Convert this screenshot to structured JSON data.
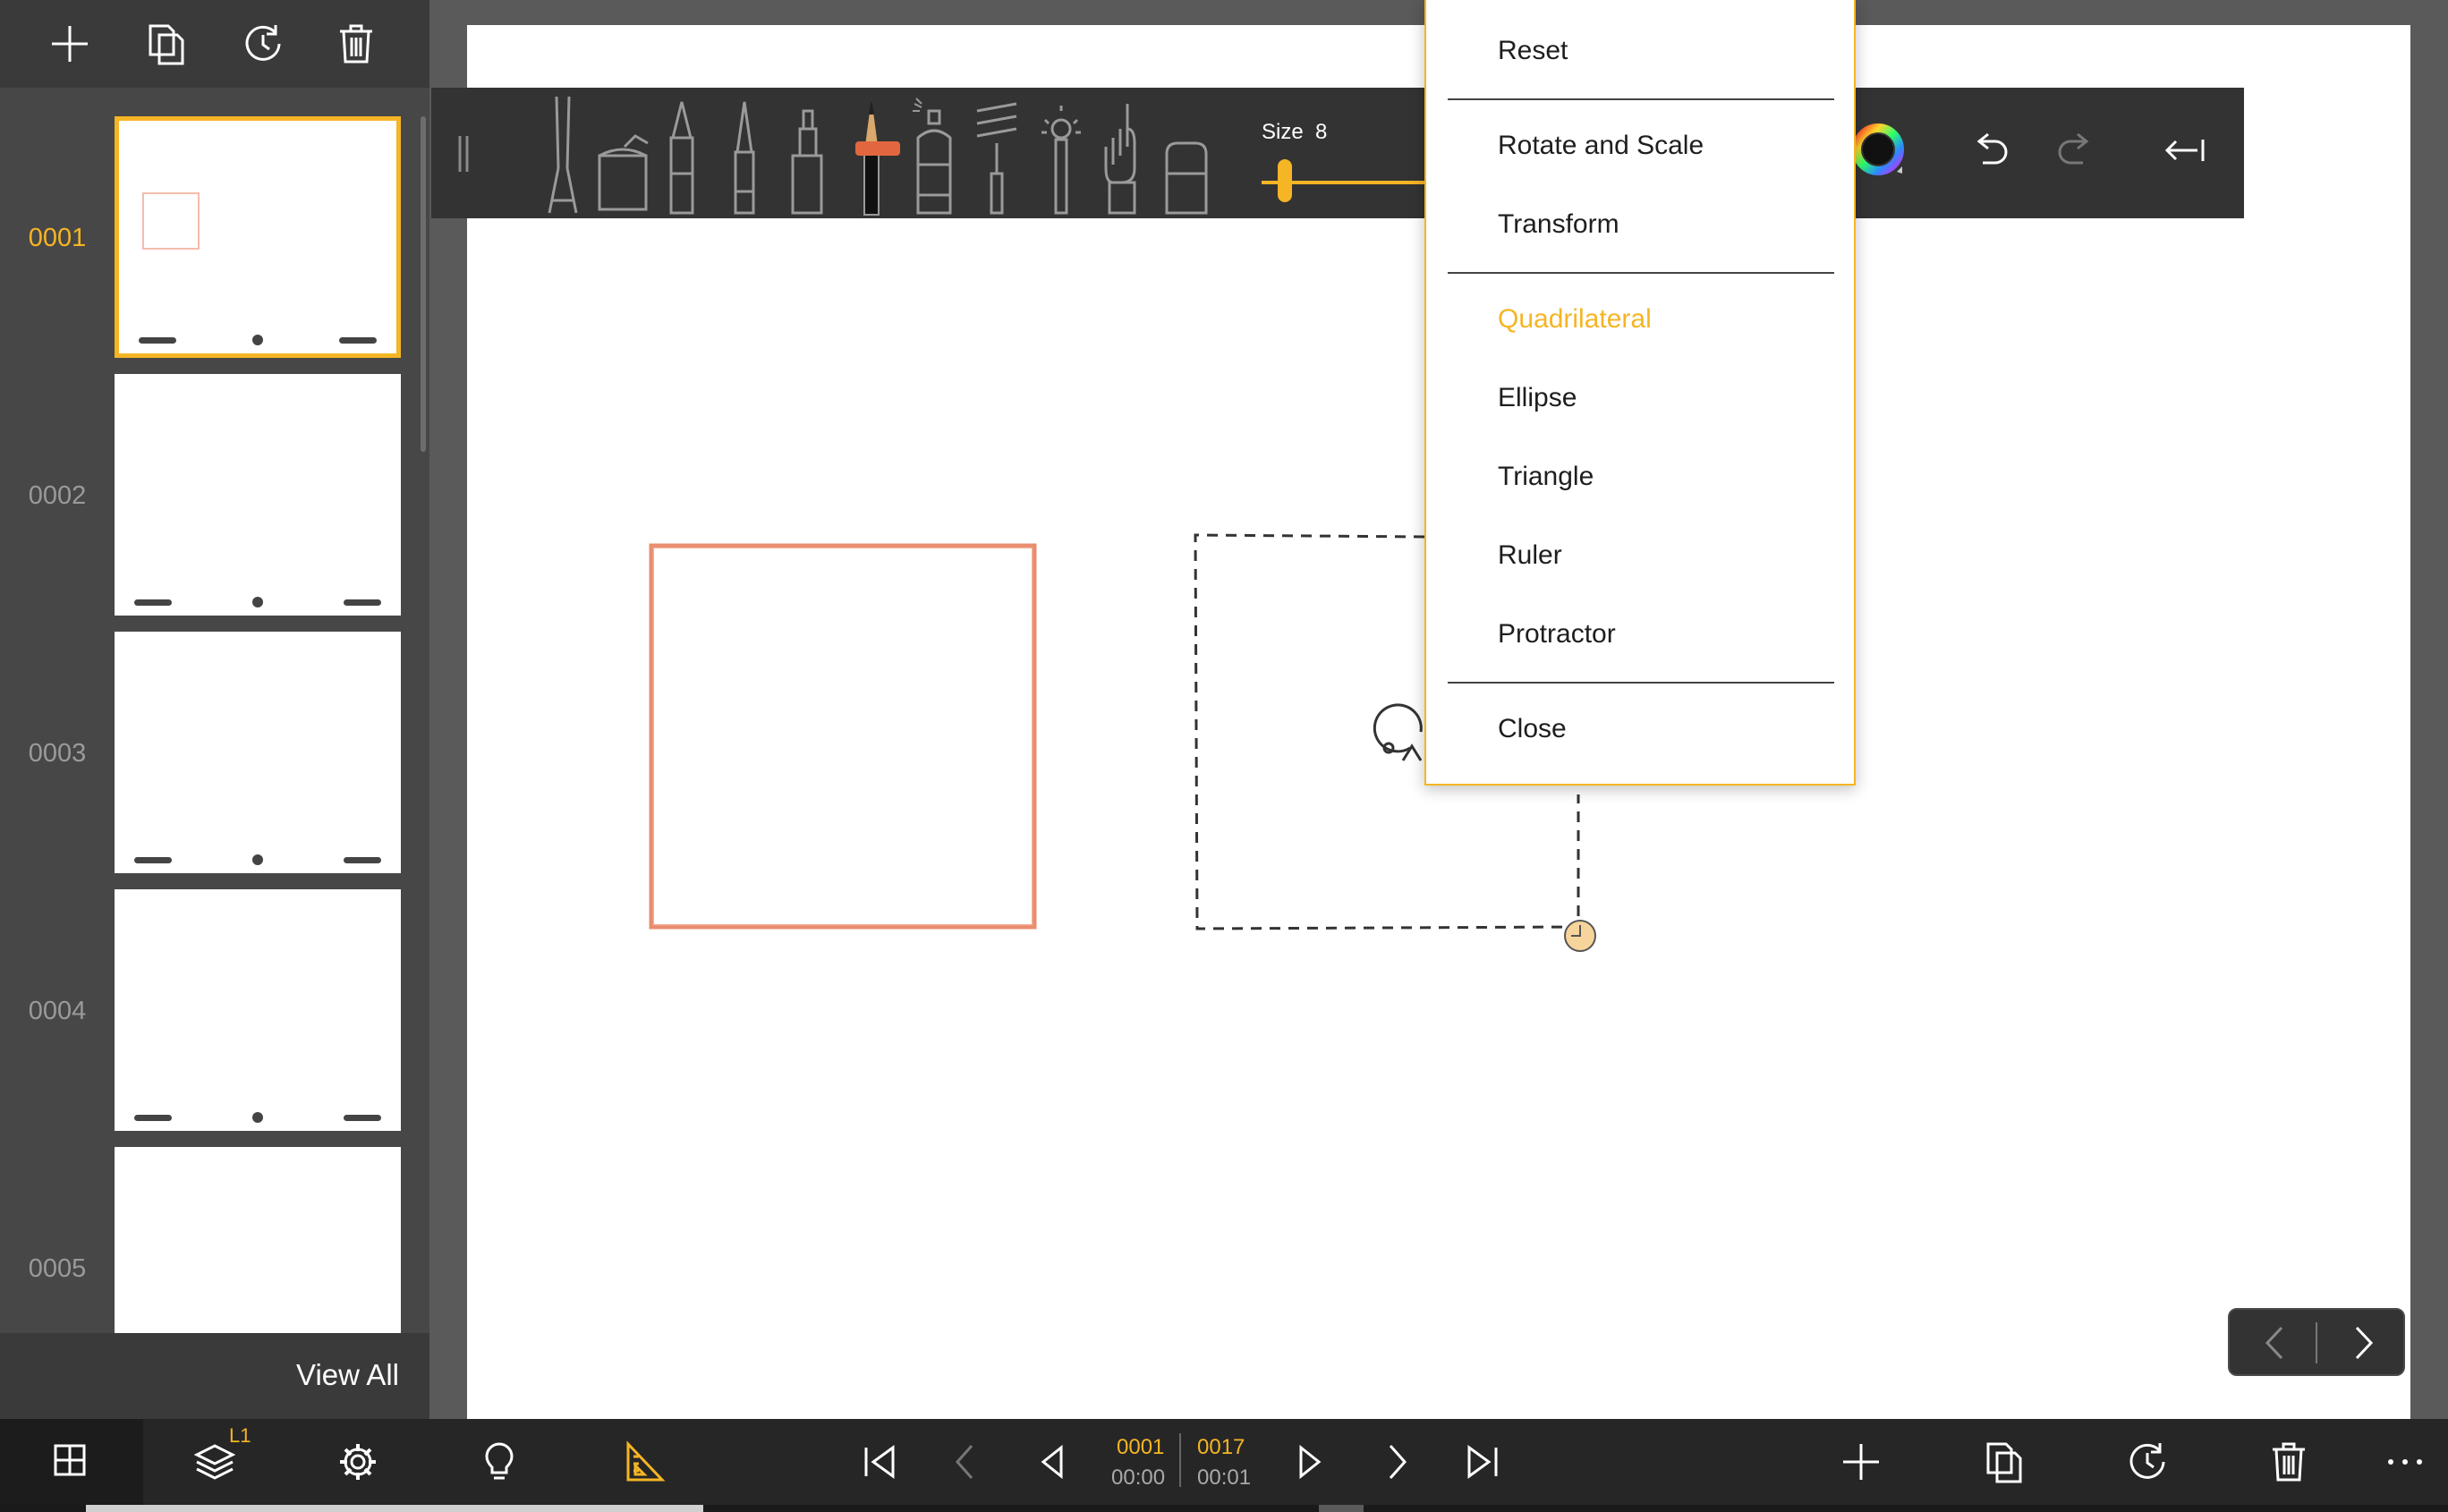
{
  "app": {
    "accent_color": "#f5b524",
    "pencil_color": "#e2673f"
  },
  "left_toolbar": {
    "buttons": [
      "add-frame",
      "duplicate-frame",
      "reset-frame",
      "delete-frame"
    ]
  },
  "frames": [
    {
      "number": "0001",
      "selected": true
    },
    {
      "number": "0002",
      "selected": false
    },
    {
      "number": "0003",
      "selected": false
    },
    {
      "number": "0004",
      "selected": false
    },
    {
      "number": "0005",
      "selected": false
    }
  ],
  "view_all_label": "View All",
  "toolbar": {
    "tools": [
      "scissors",
      "paint-bucket",
      "fountain-pen",
      "ink-pen",
      "marker",
      "pencil",
      "spray-can",
      "paint-roller",
      "stamp",
      "finger",
      "eraser"
    ],
    "active_tool": "pencil",
    "size_label": "Size",
    "size_value": "8",
    "size_fraction": 0.08,
    "color_wheel_icon": "color-wheel-icon",
    "undo_icon": "undo-icon",
    "redo_icon": "redo-icon",
    "collapse_icon": "collapse-icon"
  },
  "menu": {
    "items": {
      "reset": "Reset",
      "rotate_scale": "Rotate and Scale",
      "transform": "Transform",
      "quadrilateral": "Quadrilateral",
      "ellipse": "Ellipse",
      "triangle": "Triangle",
      "ruler": "Ruler",
      "protractor": "Protractor",
      "close": "Close"
    },
    "selected": "Quadrilateral"
  },
  "bottom_bar": {
    "layer_badge": "L1",
    "current_frame": "0001",
    "current_time": "00:00",
    "total_frames": "0017",
    "total_time": "00:01"
  }
}
